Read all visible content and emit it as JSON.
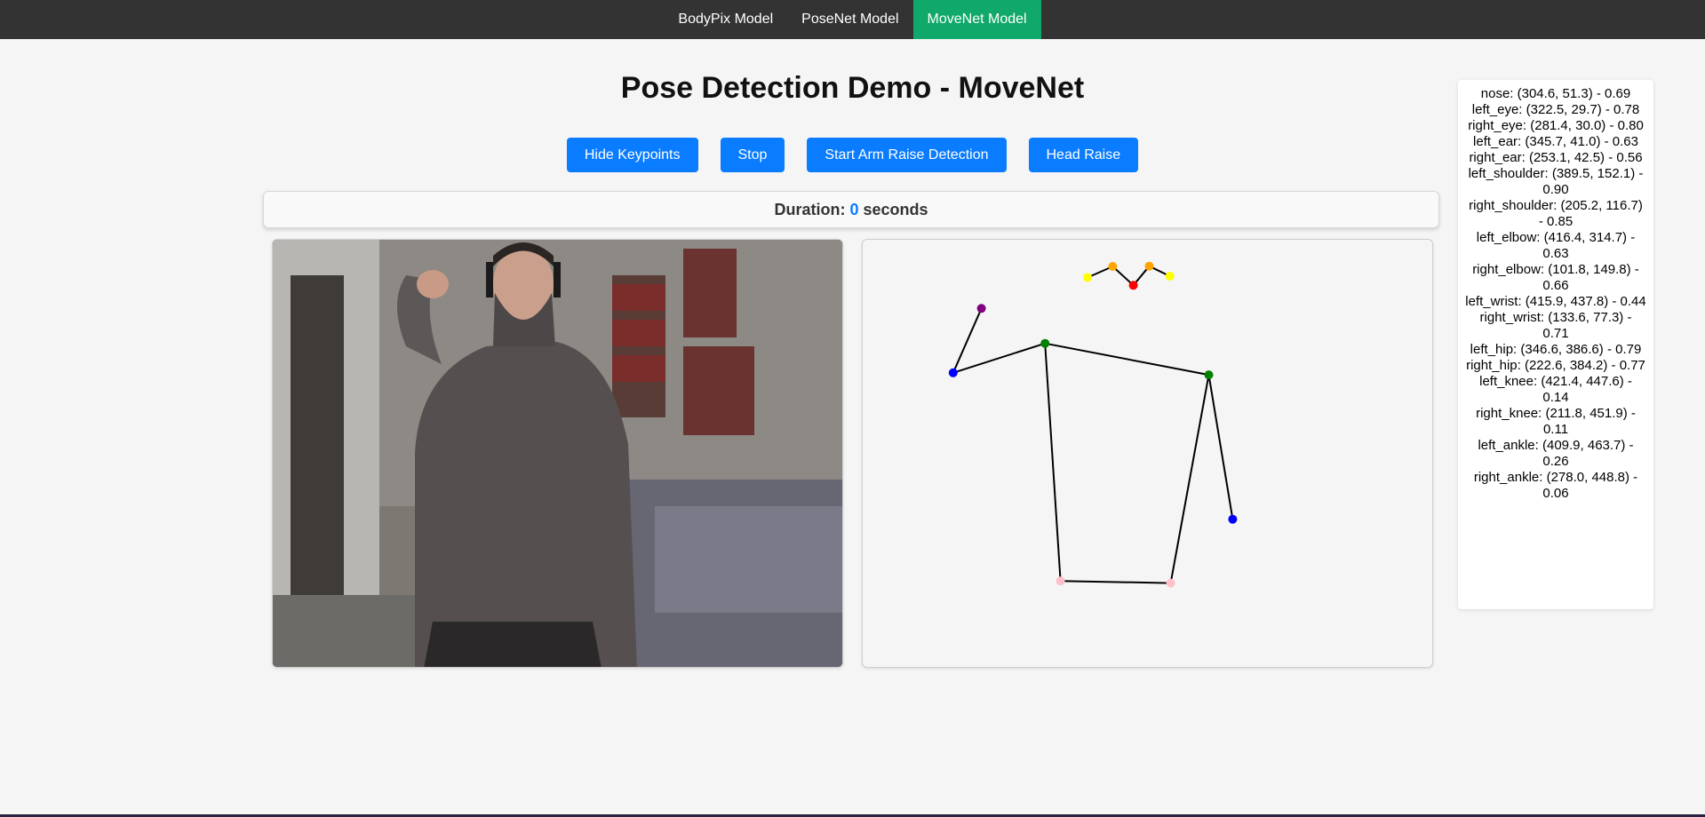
{
  "nav": {
    "items": [
      {
        "label": "BodyPix Model",
        "active": false
      },
      {
        "label": "PoseNet Model",
        "active": false
      },
      {
        "label": "MoveNet Model",
        "active": true
      }
    ]
  },
  "title": "Pose Detection Demo - MoveNet",
  "buttons": {
    "hide_keypoints": "Hide Keypoints",
    "stop": "Stop",
    "arm_raise": "Start Arm Raise Detection",
    "head_raise": "Head Raise"
  },
  "duration": {
    "label": "Duration:",
    "value": "0",
    "unit": "seconds"
  },
  "video": {
    "description": "webcam feed"
  },
  "keypoints": [
    "nose: (304.6, 51.3) - 0.69",
    "left_eye: (322.5, 29.7) - 0.78",
    "right_eye: (281.4, 30.0) - 0.80",
    "left_ear: (345.7, 41.0) - 0.63",
    "right_ear: (253.1, 42.5) - 0.56",
    "left_shoulder: (389.5, 152.1) - 0.90",
    "right_shoulder: (205.2, 116.7) - 0.85",
    "left_elbow: (416.4, 314.7) - 0.63",
    "right_elbow: (101.8, 149.8) - 0.66",
    "left_wrist: (415.9, 437.8) - 0.44",
    "right_wrist: (133.6, 77.3) - 0.71",
    "left_hip: (346.6, 386.6) - 0.79",
    "right_hip: (222.6, 384.2) - 0.77",
    "left_knee: (421.4, 447.6) - 0.14",
    "right_knee: (211.8, 451.9) - 0.11",
    "left_ankle: (409.9, 463.7) - 0.26",
    "right_ankle: (278.0, 448.8) - 0.06"
  ],
  "colors": {
    "nav_bg": "#333333",
    "nav_active": "#11a86b",
    "button": "#0a7cff",
    "duration_value": "#0a7cff",
    "nose": "#ff0000",
    "eye": "#ffa500",
    "ear": "#ffff00",
    "shoulder": "#008000",
    "elbow": "#0000ff",
    "wrist": "#800080",
    "hip": "#ffc0cb"
  }
}
